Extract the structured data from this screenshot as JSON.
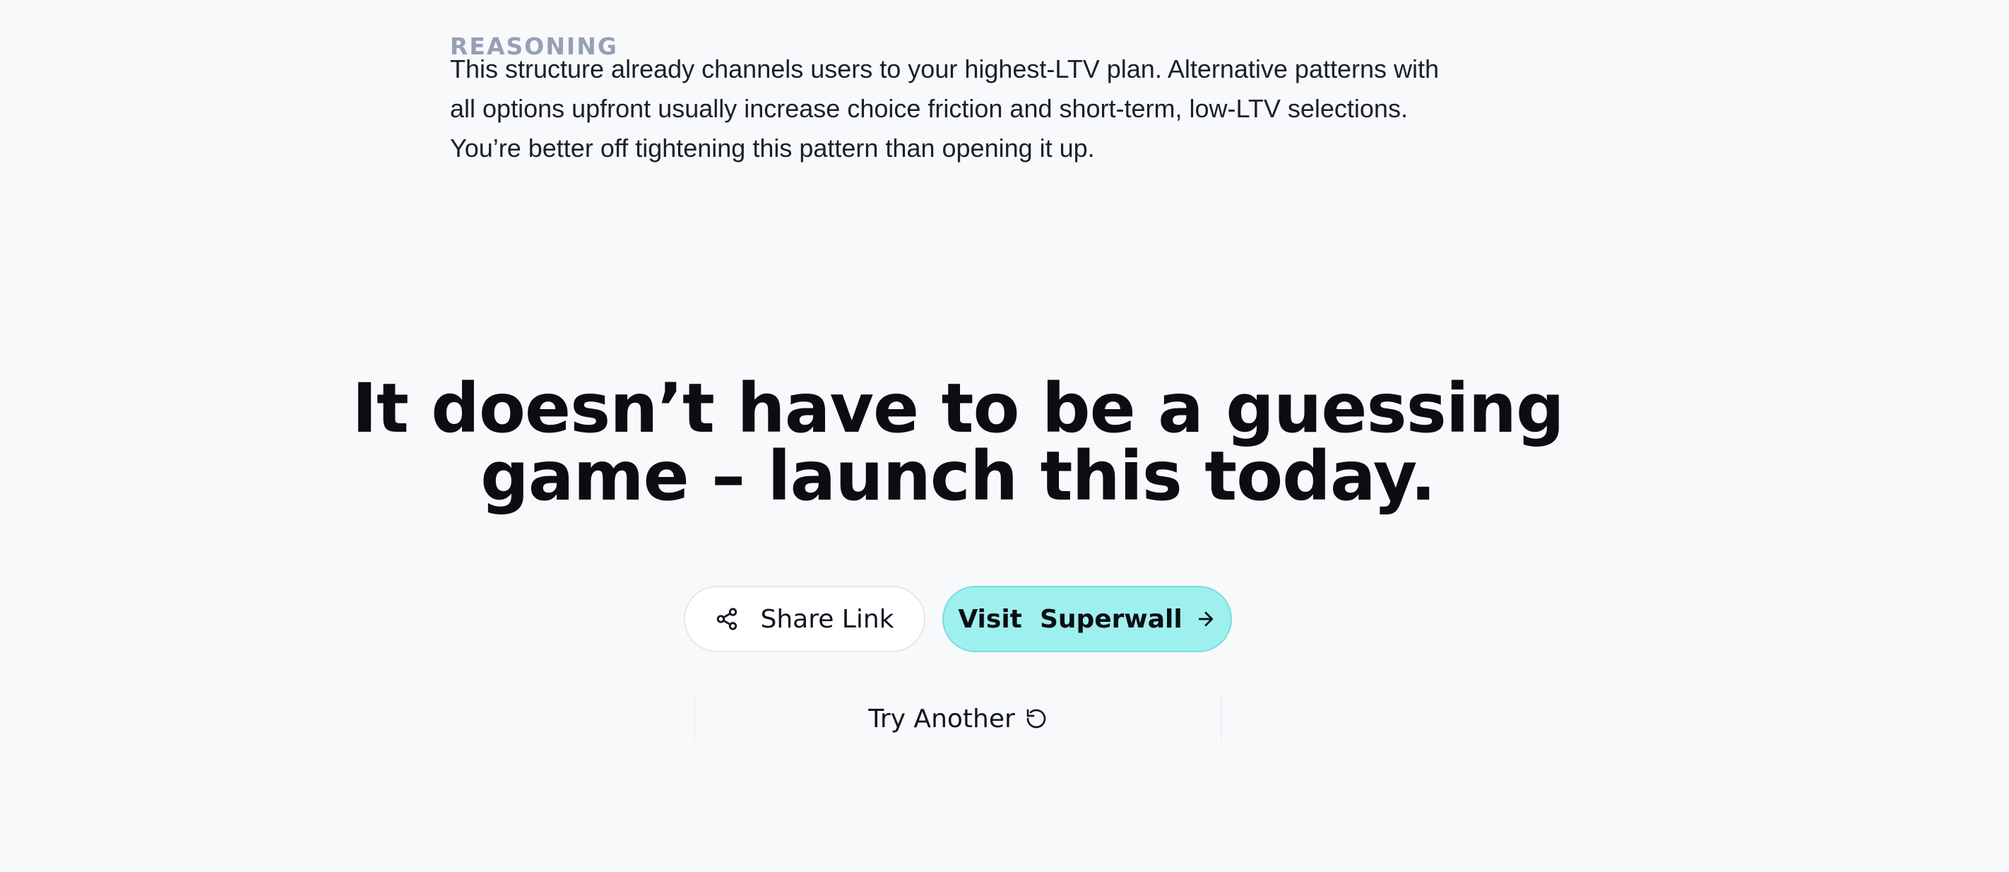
{
  "reasoning": {
    "label": "REASONING",
    "lines": [
      "This structure already channels users to your highest-LTV plan. Alternative patterns with",
      "all options upfront usually increase choice friction and short-term, low-LTV selections.",
      "You’re better off tightening this pattern than opening it up."
    ]
  },
  "cta": {
    "headline_lines": [
      "It doesn’t have to be a guessing",
      "game – launch this today."
    ],
    "share_label": "Share Link",
    "visit_label": "Visit  Superwall",
    "try_another_label": "Try Another"
  },
  "colors": {
    "background": "#f8f9fb",
    "accent": "#9ef0ef",
    "label_muted": "#96a0b5"
  },
  "icons": {
    "share": "share-icon",
    "arrow": "arrow-right-icon",
    "retry": "refresh-icon"
  }
}
